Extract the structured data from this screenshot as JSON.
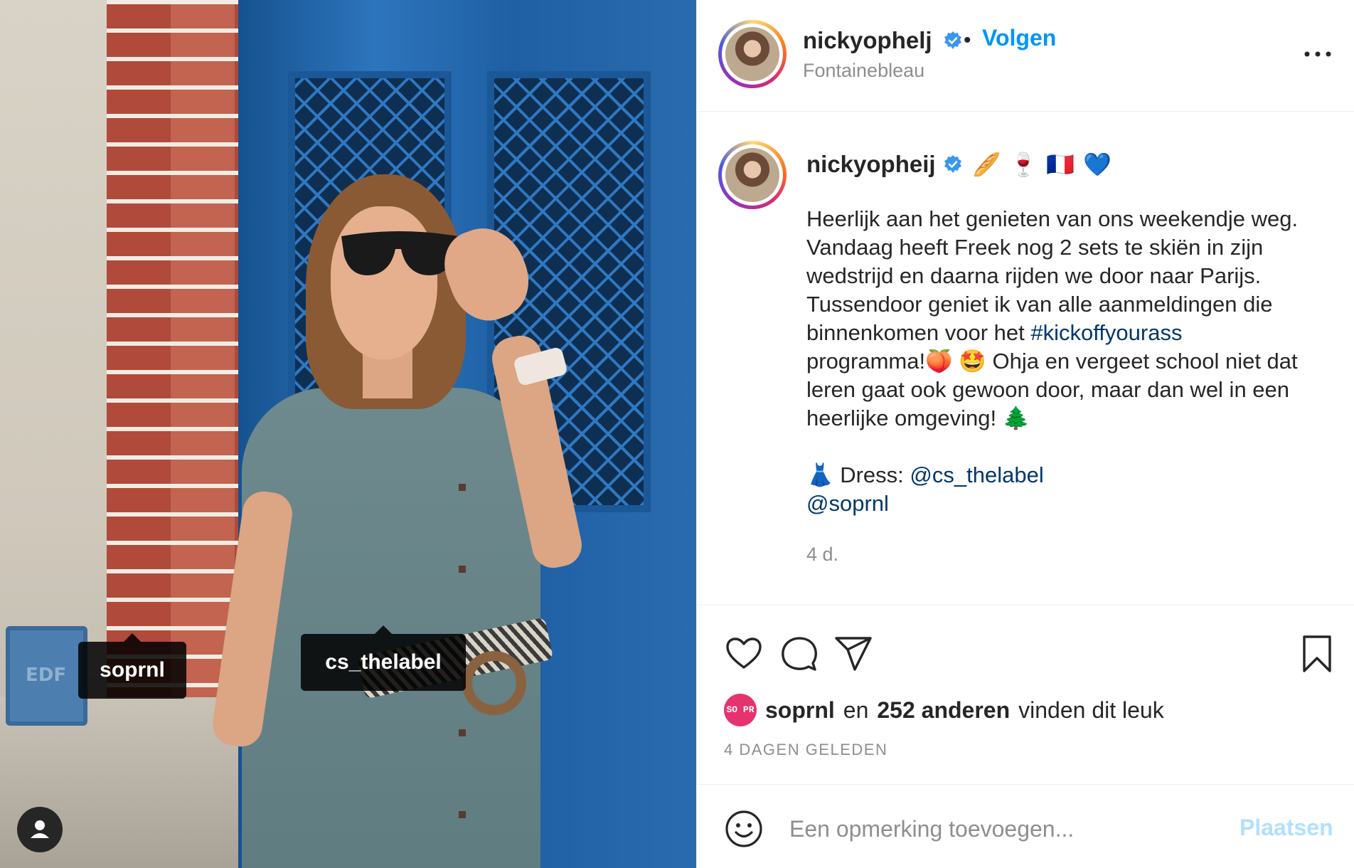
{
  "photo": {
    "tags": [
      {
        "label": "soprnl"
      },
      {
        "label": "cs_thelabel"
      }
    ],
    "sign_text": "EDF"
  },
  "header": {
    "username": "nickyophelj",
    "separator": "•",
    "follow_label": "Volgen",
    "location": "Fontainebleau"
  },
  "caption": {
    "username": "nickyopheij",
    "emojis": [
      "🥖",
      "🍷",
      "🇫🇷",
      "💙"
    ],
    "lines": [
      "Heerlijk aan het genieten van ons weekendje weg.",
      "Vandaag heeft Freek nog 2 sets te skiën in zijn",
      "wedstrijd en daarna rijden we door naar Parijs.",
      "Tussendoor geniet ik van alle aanmeldingen die",
      "binnenkomen voor het"
    ],
    "hashtag": "#kickoffyourass",
    "line6_pre": "programma!",
    "line6_emojis": "🍑 🤩",
    "line6_post": " Ohja en vergeet school niet dat",
    "line7": "leren gaat ook gewoon door, maar dan wel in een",
    "line8": "heerlijke omgeving! 🌲",
    "dress_emoji": "👗",
    "dress_label": " Dress: ",
    "mention1": "@cs_thelabel",
    "mention2": "@soprnl",
    "age": "4 d."
  },
  "actions": {
    "icons": [
      "heart-icon",
      "comment-icon",
      "share-icon",
      "bookmark-icon"
    ],
    "likes_avatar_text": "SO PR",
    "likes_user": "soprnl",
    "likes_en": "en",
    "likes_count": "252 anderen",
    "likes_suffix": "vinden dit leuk",
    "date": "4 DAGEN GELEDEN"
  },
  "comment": {
    "placeholder": "Een opmerking toevoegen...",
    "post_label": "Plaatsen"
  },
  "colors": {
    "accent": "#0095f6",
    "link": "#00376b",
    "muted": "#8e8e8e",
    "post_disabled": "#b2dffc"
  }
}
